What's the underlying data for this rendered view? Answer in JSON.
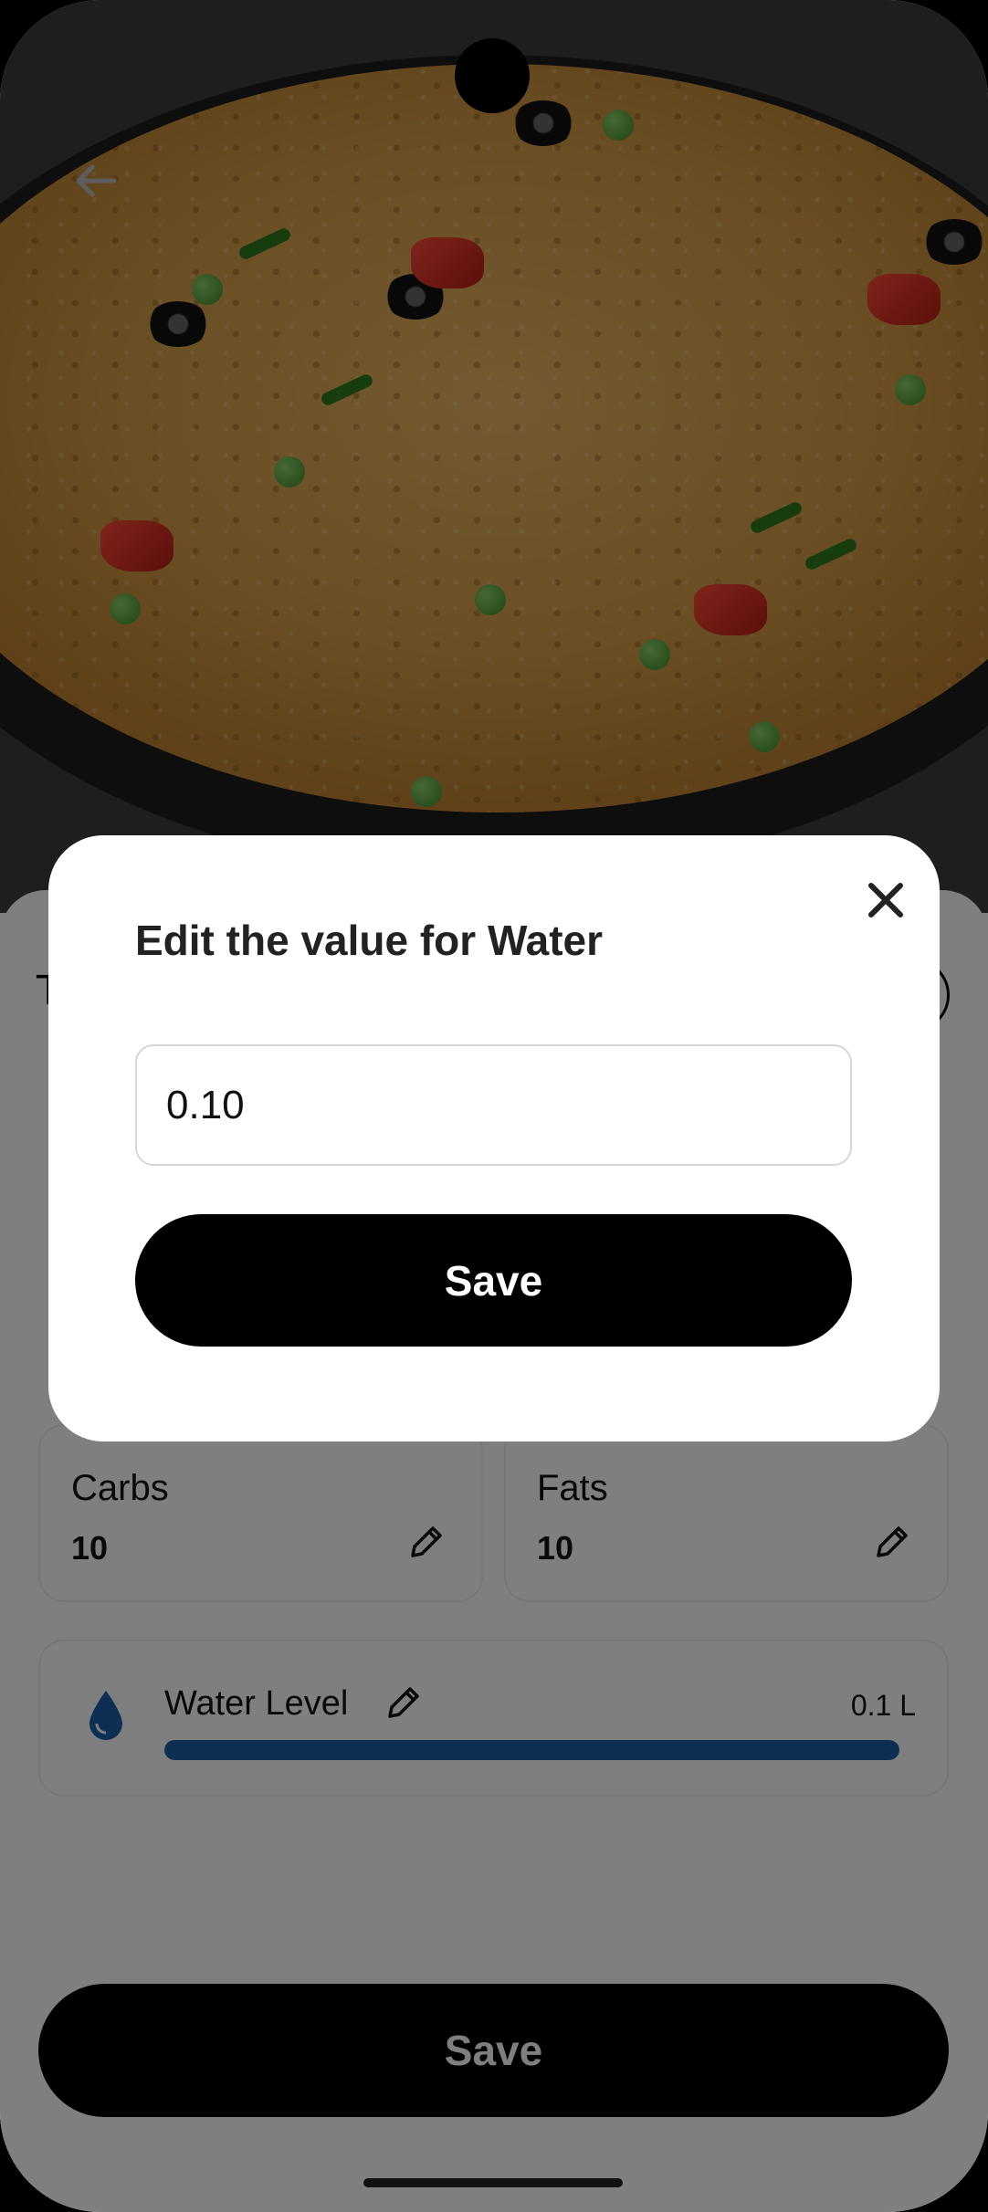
{
  "colors": {
    "primary": "#000000",
    "water_fill": "#1a5fa8",
    "water_icon": "#1a5fa8",
    "card_border": "#eeeeee"
  },
  "header": {
    "back_icon": "arrow-left-icon"
  },
  "sheet": {
    "macros": [
      {
        "label": "Carbs",
        "value": "10",
        "edit_icon": "pencil-icon"
      },
      {
        "label": "Fats",
        "value": "10",
        "edit_icon": "pencil-icon"
      }
    ],
    "water": {
      "icon": "water-drop-icon",
      "label": "Water Level",
      "edit_icon": "pencil-icon",
      "amount_text": "0.1 L",
      "fill_fraction": 1.0
    },
    "save_label": "Save"
  },
  "dialog": {
    "title": "Edit the value for Water",
    "close_icon": "close-icon",
    "input_value": "0.10",
    "save_label": "Save"
  }
}
